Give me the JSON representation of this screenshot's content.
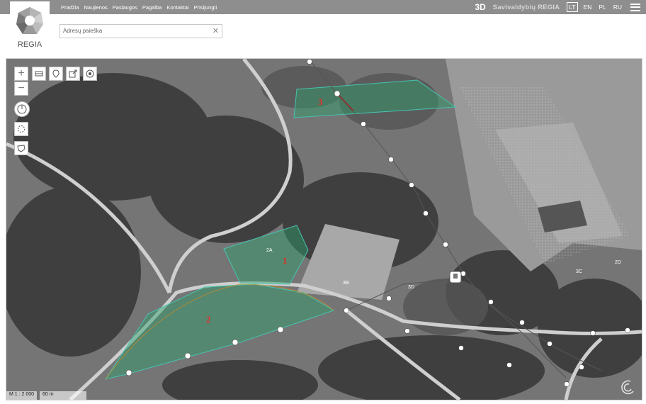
{
  "header": {
    "nav": [
      "Pradžia",
      "Naujienos",
      "Paslaugos",
      "Pagalba",
      "Kontaktai",
      "Prisijungti"
    ],
    "three_d": "3D",
    "brand_label": "Savivaldybių REGIA",
    "languages": [
      "LT",
      "EN",
      "PL",
      "RU"
    ],
    "active_language": "LT"
  },
  "logo": {
    "text": "REGIA"
  },
  "search": {
    "placeholder": "Adresų paieška",
    "clear_icon": "close-icon"
  },
  "map": {
    "parcels": [
      {
        "label": "1"
      },
      {
        "label": "2"
      },
      {
        "label": "3"
      }
    ],
    "map_labels": [
      "2A",
      "3B",
      "3D",
      "3C",
      "2D"
    ],
    "scale": {
      "ratio": "M 1 : 2 000",
      "distance": "60 m"
    }
  },
  "colors": {
    "topbar": "#8e8e8e",
    "parcel_fill": "#2ea06a",
    "parcel_label": "#e0302a",
    "boundary_line": "#c01010"
  }
}
